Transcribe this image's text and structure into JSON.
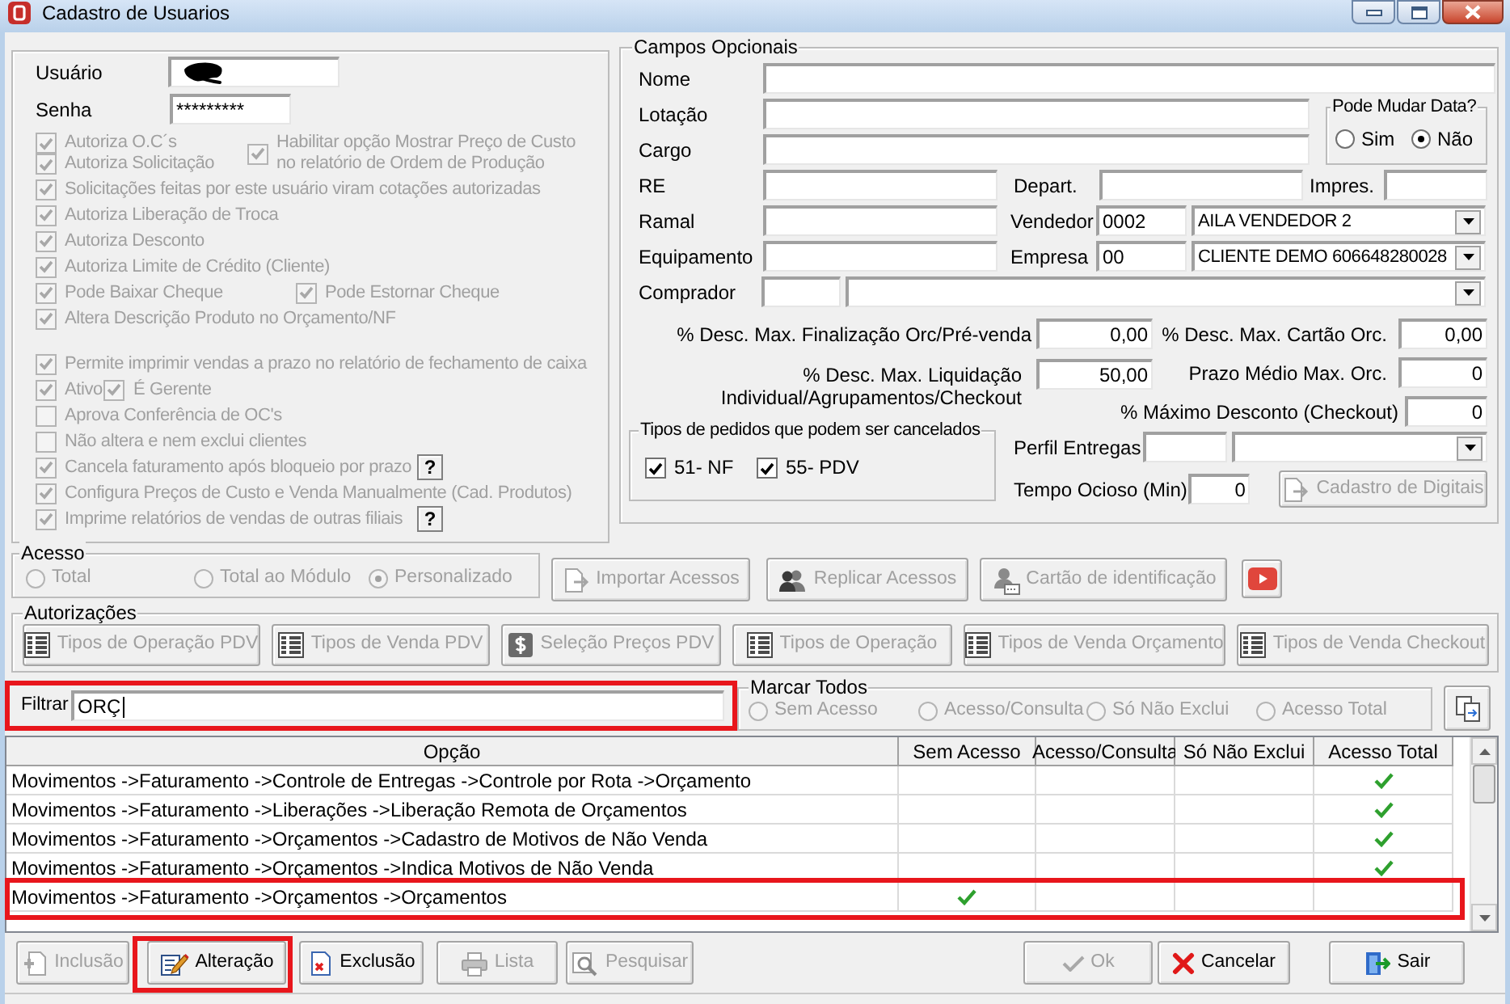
{
  "window": {
    "title": "Cadastro de Usuarios"
  },
  "login": [
    {
      "label": "Usuário",
      "redacted": true
    },
    {
      "label": "Senha",
      "value": "*********",
      "redacted": false
    }
  ],
  "permissions_top": {
    "left": [
      {
        "label": "Autoriza O.C´s",
        "checked": true,
        "disabled": true
      },
      {
        "label": "Autoriza Solicitação",
        "checked": true,
        "disabled": true
      }
    ],
    "right": {
      "label": "Habilitar opção Mostrar Preço de Custo\nno relatório de Ordem de Produção",
      "checked": true,
      "disabled": true
    }
  },
  "permission_groups": [
    [
      {
        "kind": "columns",
        "items": [
          {
            "label": "Solicitações feitas por este usuário viram cotações autorizadas",
            "checked": true,
            "disabled": true
          }
        ]
      },
      {
        "kind": "columns",
        "items": [
          {
            "label": "Autoriza Liberação de Troca",
            "checked": true,
            "disabled": true
          }
        ]
      },
      {
        "kind": "columns",
        "items": [
          {
            "label": "Autoriza Desconto",
            "checked": true,
            "disabled": true
          }
        ]
      },
      {
        "kind": "columns",
        "items": [
          {
            "label": "Autoriza Limite de Crédito (Cliente)",
            "checked": true,
            "disabled": true
          }
        ]
      },
      {
        "kind": "columns",
        "items": [
          {
            "label": "Pode Baixar Cheque",
            "checked": true,
            "disabled": true
          },
          {
            "label": "Pode Estornar Cheque",
            "checked": true,
            "disabled": true
          }
        ]
      },
      {
        "kind": "columns",
        "items": [
          {
            "label": "Altera Descrição Produto no Orçamento/NF",
            "checked": true,
            "disabled": true
          }
        ]
      }
    ],
    [
      {
        "kind": "columns",
        "items": [
          {
            "label": "Permite imprimir vendas a prazo no relatório de fechamento de caixa",
            "checked": true,
            "disabled": true
          }
        ]
      },
      {
        "kind": "inline",
        "items": [
          {
            "label": "Ativo",
            "checked": true,
            "disabled": true
          },
          {
            "label": "É Gerente",
            "checked": true,
            "disabled": true
          }
        ]
      },
      {
        "kind": "columns",
        "items": [
          {
            "label": "Aprova Conferência de OC's",
            "checked": false,
            "disabled": true
          }
        ]
      },
      {
        "kind": "columns",
        "items": [
          {
            "label": "Não altera e nem exclui clientes",
            "checked": false,
            "disabled": true
          }
        ]
      },
      {
        "kind": "columns",
        "items": [
          {
            "label": "Cancela faturamento após bloqueio por prazo",
            "checked": true,
            "disabled": true
          }
        ],
        "help": "?"
      },
      {
        "kind": "columns",
        "items": [
          {
            "label": "Configura Preços de Custo e Venda Manualmente (Cad. Produtos)",
            "checked": true,
            "disabled": true
          }
        ]
      },
      {
        "kind": "columns",
        "items": [
          {
            "label": "Imprime relatórios de vendas de outras filiais",
            "checked": true,
            "disabled": true
          }
        ],
        "help": "?"
      }
    ]
  ],
  "optional_panel": {
    "title": "Campos Opcionais",
    "nome": {
      "label": "Nome"
    },
    "lotacao": {
      "label": "Lotação"
    },
    "cargo": {
      "label": "Cargo"
    },
    "date_change": {
      "title": "Pode Mudar Data?",
      "options": [
        {
          "label": "Sim",
          "selected": false
        },
        {
          "label": "Não",
          "selected": true
        }
      ]
    },
    "re": {
      "label": "RE"
    },
    "depart": {
      "label": "Depart."
    },
    "impres": {
      "label": "Impres."
    },
    "ramal": {
      "label": "Ramal"
    },
    "vendedor": {
      "label": "Vendedor",
      "code": "0002",
      "name": "AILA VENDEDOR 2"
    },
    "equipamento": {
      "label": "Equipamento"
    },
    "empresa": {
      "label": "Empresa",
      "code": "00",
      "name": "CLIENTE DEMO 606648280028"
    },
    "comprador": {
      "label": "Comprador"
    },
    "discounts_left": [
      {
        "label": "% Desc. Max. Finalização Orc/Pré-venda",
        "value": "0,00"
      },
      {
        "label": "% Desc. Max. Liquidação\nIndividual/Agrupamentos/Checkout",
        "value": "50,00"
      }
    ],
    "discounts_right": [
      {
        "label": "% Desc. Max. Cartão Orc.",
        "value": "0,00"
      },
      {
        "label": "Prazo Médio Max. Orc.",
        "value": "0"
      },
      {
        "label": "% Máximo Desconto (Checkout)",
        "value": "0"
      }
    ],
    "cancel_types": {
      "title": "Tipos de pedidos que podem ser cancelados",
      "options": [
        {
          "label": "51- NF",
          "checked": true
        },
        {
          "label": "55- PDV",
          "checked": true
        }
      ]
    },
    "perfil_entregas": {
      "label": "Perfil Entregas"
    },
    "tempo_ocioso": {
      "label": "Tempo Ocioso (Min)",
      "value": "0"
    },
    "fingerprint_button": {
      "label": "Cadastro de Digitais",
      "disabled": true
    }
  },
  "access": {
    "title": "Acesso",
    "options": [
      {
        "label": "Total",
        "selected": false,
        "disabled": true
      },
      {
        "label": "Total ao Módulo",
        "selected": false,
        "disabled": true
      },
      {
        "label": "Personalizado",
        "selected": true,
        "disabled": true
      }
    ],
    "buttons": [
      {
        "label": "Importar Acessos",
        "disabled": true
      },
      {
        "label": "Replicar Acessos",
        "disabled": true
      },
      {
        "label": "Cartão de identificação",
        "disabled": true
      }
    ]
  },
  "authorizations": {
    "title": "Autorizações",
    "buttons": [
      {
        "label": "Tipos de Operação PDV",
        "disabled": true
      },
      {
        "label": "Tipos de Venda PDV",
        "disabled": true
      },
      {
        "label": "Seleção Preços PDV",
        "disabled": true
      },
      {
        "label": "Tipos de Operação",
        "disabled": true
      },
      {
        "label": "Tipos de Venda Orçamento",
        "disabled": true
      },
      {
        "label": "Tipos de Venda Checkout",
        "disabled": true
      }
    ]
  },
  "filter": {
    "label": "Filtrar",
    "value": "ORÇ",
    "focused": true,
    "annotated": true
  },
  "mark_all": {
    "title": "Marcar Todos",
    "options": [
      {
        "label": "Sem Acesso",
        "selected": false,
        "disabled": true
      },
      {
        "label": "Acesso/Consulta",
        "selected": false,
        "disabled": true
      },
      {
        "label": "Só Não Exclui",
        "selected": false,
        "disabled": true
      },
      {
        "label": "Acesso Total",
        "selected": false,
        "disabled": true
      }
    ]
  },
  "table": {
    "columns": [
      "Opção",
      "Sem Acesso",
      "Acesso/Consulta",
      "Só Não Exclui",
      "Acesso Total"
    ],
    "rows": [
      {
        "option": "Movimentos ->Faturamento ->Controle de Entregas ->Controle por Rota ->Orçamento",
        "checks": [
          false,
          false,
          false,
          true
        ],
        "annotated": false
      },
      {
        "option": "Movimentos ->Faturamento ->Liberações ->Liberação Remota de Orçamentos",
        "checks": [
          false,
          false,
          false,
          true
        ],
        "annotated": false
      },
      {
        "option": "Movimentos ->Faturamento ->Orçamentos ->Cadastro de Motivos de Não Venda",
        "checks": [
          false,
          false,
          false,
          true
        ],
        "annotated": false
      },
      {
        "option": "Movimentos ->Faturamento ->Orçamentos ->Indica Motivos de Não Venda",
        "checks": [
          false,
          false,
          false,
          true
        ],
        "annotated": false
      },
      {
        "option": "Movimentos ->Faturamento ->Orçamentos ->Orçamentos",
        "checks": [
          true,
          false,
          false,
          false
        ],
        "annotated": true
      }
    ]
  },
  "actions": {
    "left": [
      {
        "label": "Inclusão",
        "disabled": true,
        "annotated": false
      },
      {
        "label": "Alteração",
        "disabled": false,
        "annotated": true
      },
      {
        "label": "Exclusão",
        "disabled": false,
        "annotated": false
      },
      {
        "label": "Lista",
        "disabled": true,
        "annotated": false
      },
      {
        "label": "Pesquisar",
        "disabled": true,
        "annotated": false
      }
    ],
    "right": [
      {
        "label": "Ok",
        "disabled": true,
        "annotated": false
      },
      {
        "label": "Cancelar",
        "disabled": false,
        "annotated": false
      },
      {
        "label": "Sair",
        "disabled": false,
        "annotated": false
      }
    ]
  }
}
